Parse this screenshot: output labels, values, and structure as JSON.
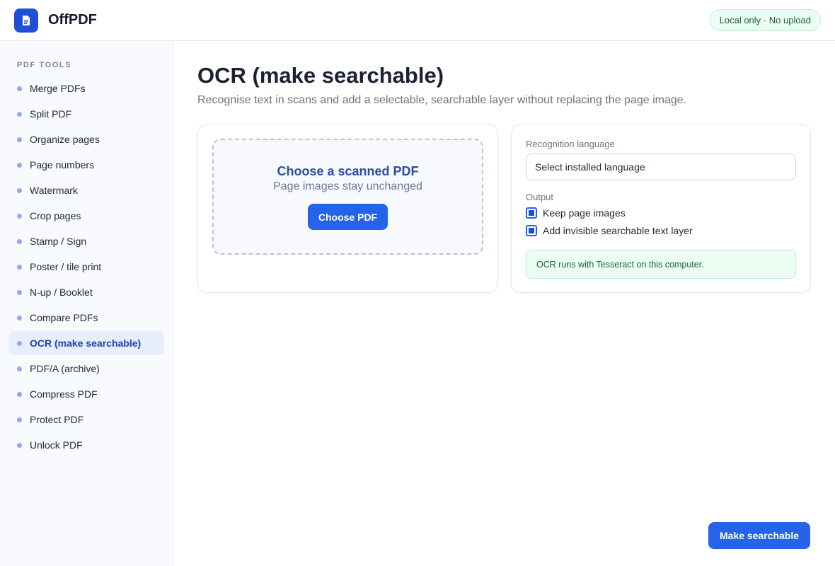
{
  "header": {
    "app_title": "OffPDF",
    "badge": "Local only · No upload",
    "logo_icon": "document-icon",
    "brand_color": "#1e4fd6"
  },
  "sidebar": {
    "heading": "PDF TOOLS",
    "active_index": 10,
    "items": [
      {
        "label": "Merge PDFs"
      },
      {
        "label": "Split PDF"
      },
      {
        "label": "Organize pages"
      },
      {
        "label": "Page numbers"
      },
      {
        "label": "Watermark"
      },
      {
        "label": "Crop pages"
      },
      {
        "label": "Stamp / Sign"
      },
      {
        "label": "Poster / tile print"
      },
      {
        "label": "N-up / Booklet"
      },
      {
        "label": "Compare PDFs"
      },
      {
        "label": "OCR (make searchable)"
      },
      {
        "label": "PDF/A (archive)"
      },
      {
        "label": "Compress PDF"
      },
      {
        "label": "Protect PDF"
      },
      {
        "label": "Unlock PDF"
      }
    ]
  },
  "main": {
    "title": "OCR (make searchable)",
    "subtitle": "Recognise text in scans and add a selectable, searchable layer without replacing the page image.",
    "dropzone": {
      "title": "Choose a scanned PDF",
      "subtitle": "Page images stay unchanged",
      "button_label": "Choose PDF"
    },
    "options": {
      "language_label": "Recognition language",
      "language_value": "Select installed language",
      "output_label": "Output",
      "checkboxes": [
        {
          "label": "Keep page images",
          "checked": true
        },
        {
          "label": "Add invisible searchable text layer",
          "checked": true
        }
      ],
      "note": "OCR runs with Tesseract on this computer."
    },
    "action_button": "Make searchable"
  }
}
